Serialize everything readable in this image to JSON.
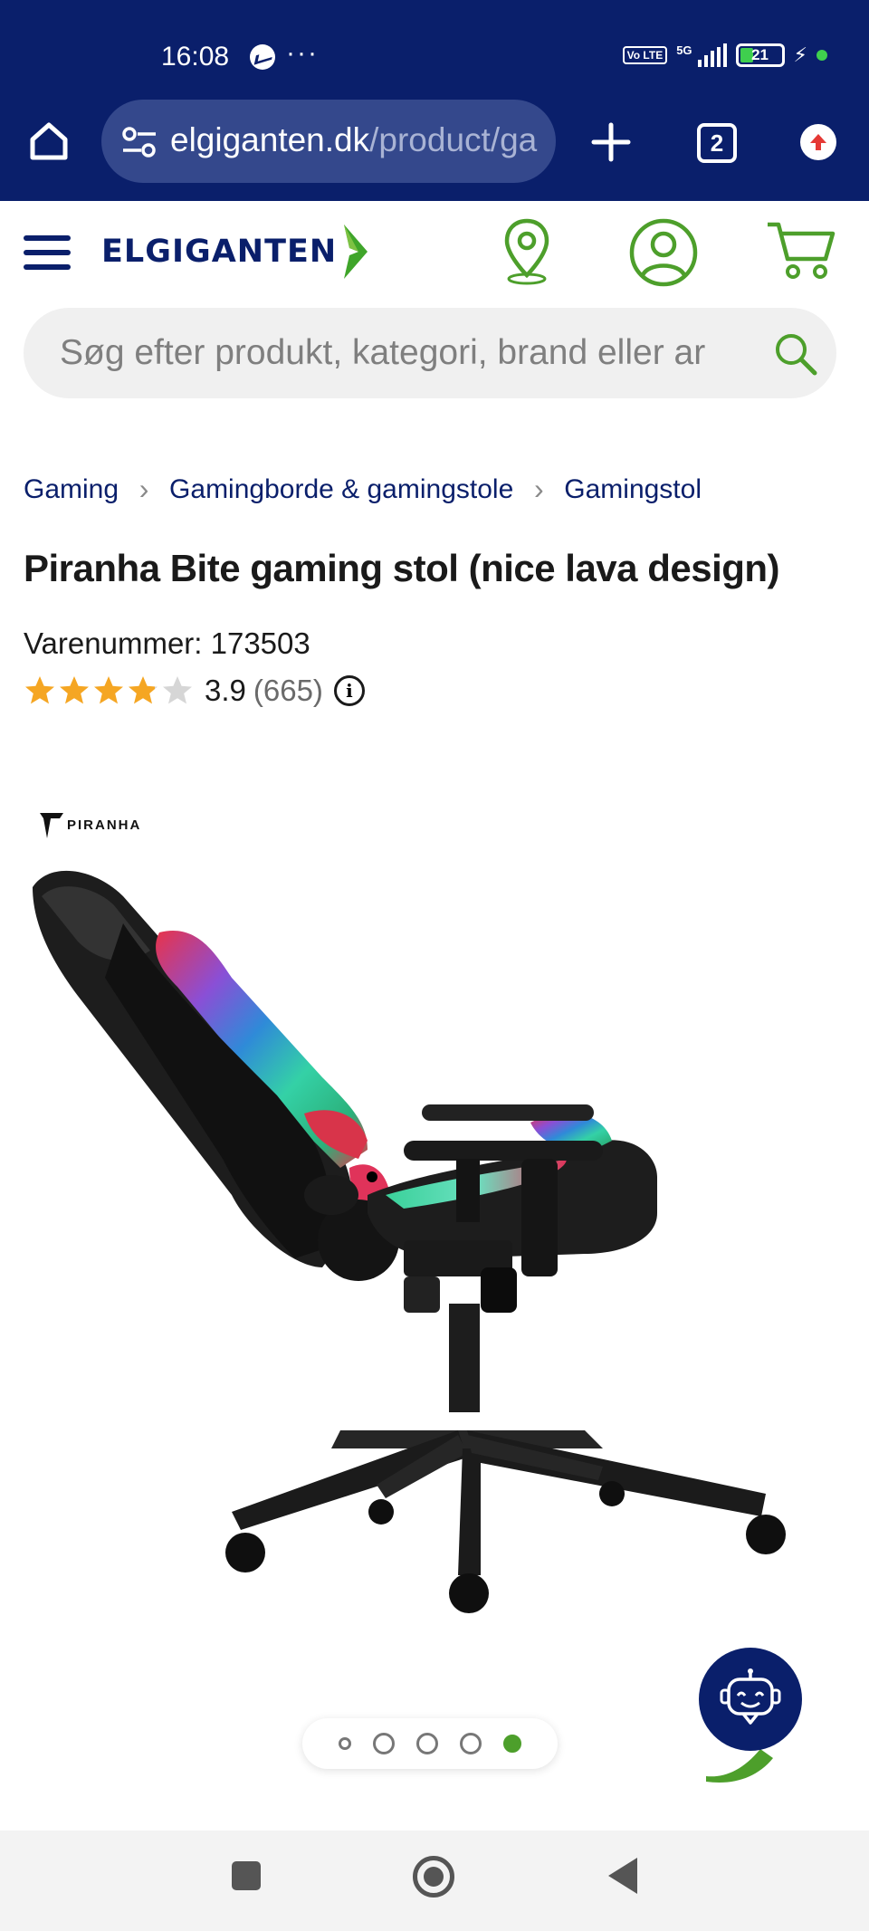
{
  "status_bar": {
    "time": "16:08",
    "dots": "···",
    "volte": "Vo LTE",
    "network": "5G",
    "battery": "21"
  },
  "browser": {
    "url_domain": "elgiganten.dk",
    "url_path": "/product/ga",
    "tab_count": "2"
  },
  "header": {
    "logo_text": "ELGIGANTEN",
    "search_placeholder": "Søg efter produkt, kategori, brand eller ar"
  },
  "breadcrumb": [
    "Gaming",
    "Gamingborde & gamingstole",
    "Gamingstol"
  ],
  "product": {
    "title": "Piranha Bite gaming stol (nice lava design)",
    "sku_label": "Varenummer:",
    "sku_value": "173503",
    "rating": 3.9,
    "rating_text": "3.9",
    "review_count": "(665)",
    "info_glyph": "i",
    "brand_text": "PIRANHA"
  },
  "gallery": {
    "slide_count": 5,
    "active_index": 4
  },
  "colors": {
    "navy": "#0a1f6b",
    "green": "#4d9f2b",
    "star": "#f5a623"
  }
}
